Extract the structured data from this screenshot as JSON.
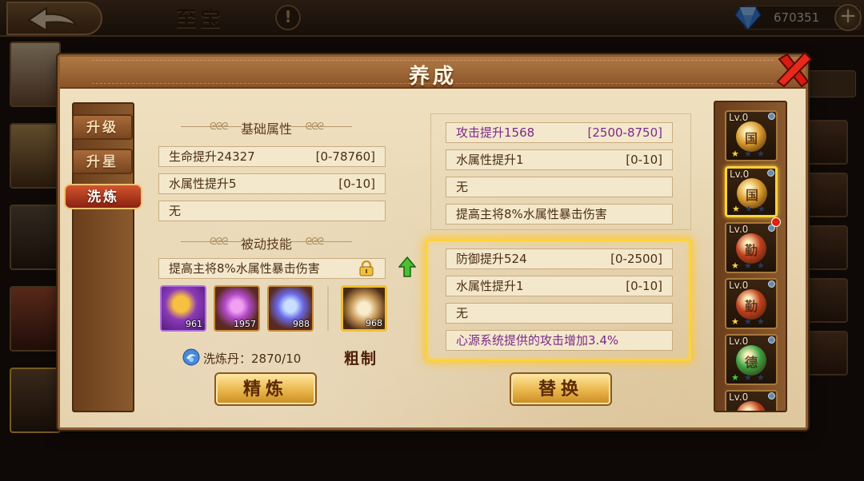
{
  "top_bar": {
    "title": "至宝",
    "info_label": "!",
    "currency": "670351",
    "plus_label": "+"
  },
  "dialog": {
    "title": "养成",
    "tabs": [
      {
        "label": "升级",
        "active": false
      },
      {
        "label": "升星",
        "active": false
      },
      {
        "label": "洗炼",
        "active": true
      }
    ],
    "base_section": {
      "heading": "基础属性",
      "rows": [
        {
          "label": "生命提升24327",
          "range": "[0-78760]"
        },
        {
          "label": "水属性提升5",
          "range": "[0-10]"
        },
        {
          "label": "无",
          "range": ""
        }
      ]
    },
    "passive_section": {
      "heading": "被动技能",
      "skill": "提高主将8%水属性暴击伤害"
    },
    "items": [
      {
        "icon": "purple-crystal-icon",
        "count": "961",
        "color": "#8a3ab8"
      },
      {
        "icon": "pink-crystal-icon",
        "count": "1957",
        "color": "#5a2a20"
      },
      {
        "icon": "blue-crystal-icon",
        "count": "988",
        "color": "#5a2a20"
      },
      {
        "icon": "scroll-icon",
        "count": "968",
        "color": "#5a2a20"
      }
    ],
    "refine_pill": {
      "label": "洗炼丹：2870/10"
    },
    "grade_label": "粗制",
    "current": {
      "rows": [
        {
          "label": "攻击提升1568",
          "range": "[2500-8750]",
          "purple": true
        },
        {
          "label": "水属性提升1",
          "range": "[0-10]",
          "purple": false
        },
        {
          "label": "无",
          "range": "",
          "purple": false
        },
        {
          "label": "提高主将8%水属性暴击伤害",
          "range": "",
          "purple": false
        }
      ]
    },
    "new": {
      "rows": [
        {
          "label": "防御提升524",
          "range": "[0-2500]",
          "purple": false
        },
        {
          "label": "水属性提升1",
          "range": "[0-10]",
          "purple": false
        },
        {
          "label": "无",
          "range": "",
          "purple": false
        },
        {
          "label": "心源系统提供的攻击增加3.4%",
          "range": "",
          "purple": true
        }
      ]
    },
    "buttons": {
      "refine": "精炼",
      "replace": "替换"
    },
    "gem_list": [
      {
        "level": "Lv.0",
        "glyph": "国",
        "color": "#d89a2a",
        "star": "#ffd040"
      },
      {
        "level": "Lv.0",
        "glyph": "国",
        "color": "#d89a2a",
        "star": "#ffd040",
        "selected": true
      },
      {
        "level": "Lv.0",
        "glyph": "勤",
        "color": "#c0401e",
        "star": "#ffd040"
      },
      {
        "level": "Lv.0",
        "glyph": "勤",
        "color": "#c0401e",
        "star": "#ffd040"
      },
      {
        "level": "Lv.0",
        "glyph": "德",
        "color": "#3aa040",
        "star": "#40d040"
      },
      {
        "level": "Lv.0",
        "glyph": "",
        "color": "#c0401e",
        "star": "#ffd040"
      }
    ]
  }
}
